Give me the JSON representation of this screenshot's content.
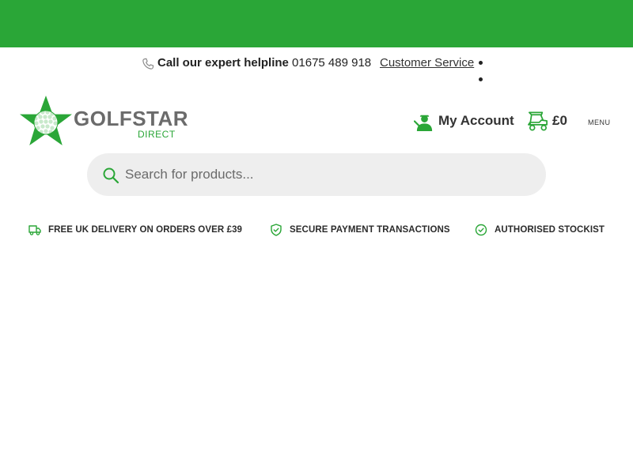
{
  "colors": {
    "brand_green": "#2aa637",
    "text_dark": "#2b2b2b",
    "logo_grey": "#6b6b6b",
    "search_bg": "#eeeeee"
  },
  "topbar": {
    "phone_icon": "phone-icon",
    "helpline_label": "Call our expert helpline",
    "helpline_number": "01675 489 918",
    "customer_service_label": "Customer Service"
  },
  "logo": {
    "word": "GOLFSTAR",
    "sub": "DIRECT",
    "icon": "golf-ball-star-icon"
  },
  "header": {
    "account_icon": "golfer-icon",
    "account_label": "My Account",
    "cart_icon": "golf-cart-icon",
    "cart_total": "£0",
    "menu_label": "MENU"
  },
  "search": {
    "icon": "search-icon",
    "value": "",
    "placeholder": "Search for products..."
  },
  "usps": [
    {
      "icon": "truck-icon",
      "label": "FREE UK DELIVERY ON ORDERS OVER £39"
    },
    {
      "icon": "shield-check-icon",
      "label": "SECURE PAYMENT TRANSACTIONS"
    },
    {
      "icon": "circle-check-icon",
      "label": "AUTHORISED STOCKIST"
    }
  ]
}
